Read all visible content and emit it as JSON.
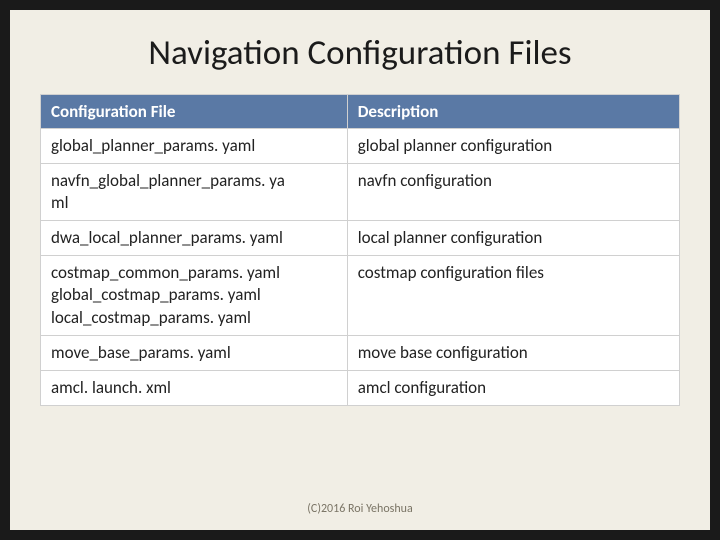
{
  "title": "Navigation Configuration Files",
  "columns": {
    "file": "Configuration File",
    "desc": "Description"
  },
  "rows": [
    {
      "file": "global_planner_params. yaml",
      "desc": "global planner configuration"
    },
    {
      "file": "navfn_global_planner_params. ya\nml",
      "desc": "navfn configuration"
    },
    {
      "file": "dwa_local_planner_params. yaml",
      "desc": "local planner configuration"
    },
    {
      "file": "costmap_common_params. yaml\nglobal_costmap_params. yaml\nlocal_costmap_params. yaml",
      "desc": "costmap configuration files"
    },
    {
      "file": "move_base_params. yaml",
      "desc": "move base configuration"
    },
    {
      "file": "amcl. launch. xml",
      "desc": "amcl configuration"
    }
  ],
  "footer": "(C)2016 Roi Yehoshua"
}
